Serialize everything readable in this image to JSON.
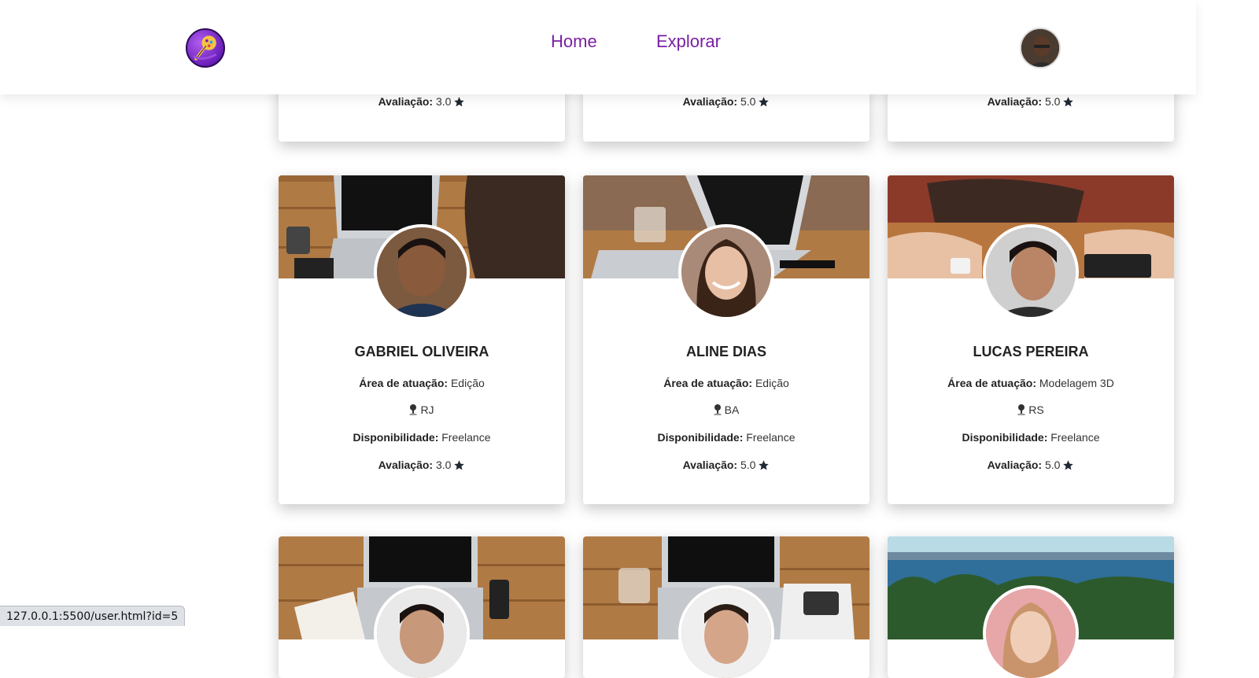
{
  "nav": {
    "home": "Home",
    "explorar": "Explorar"
  },
  "labels": {
    "area": "Área de atuação:",
    "disp": "Disponibilidade:",
    "rate": "Avaliação:"
  },
  "top_row": [
    {
      "rating": "3.0"
    },
    {
      "rating": "5.0"
    },
    {
      "rating": "5.0"
    }
  ],
  "cards": [
    {
      "name": "GABRIEL OLIVEIRA",
      "area": "Edição",
      "state": "RJ",
      "disp": "Freelance",
      "rating": "3.0"
    },
    {
      "name": "ALINE DIAS",
      "area": "Edição",
      "state": "BA",
      "disp": "Freelance",
      "rating": "5.0"
    },
    {
      "name": "LUCAS PEREIRA",
      "area": "Modelagem 3D",
      "state": "RS",
      "disp": "Freelance",
      "rating": "5.0"
    }
  ],
  "status_url": "127.0.0.1:5500/user.html?id=5",
  "colors": {
    "accent": "#7a1fa2",
    "star": "#1f2833"
  }
}
